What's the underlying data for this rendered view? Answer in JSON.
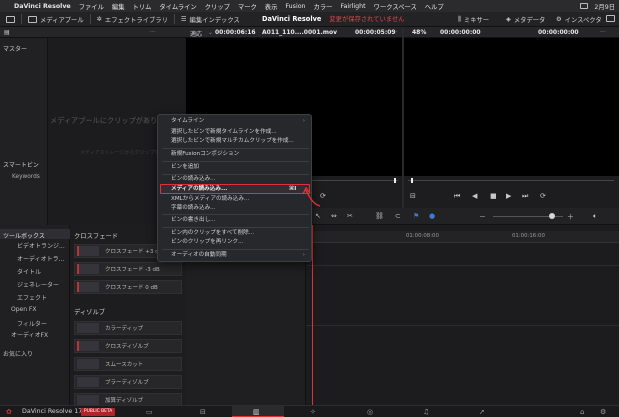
{
  "menubar": {
    "app_name": "DaVinci Resolve",
    "items": [
      "ファイル",
      "編集",
      "トリム",
      "タイムライン",
      "クリップ",
      "マーク",
      "表示",
      "Fusion",
      "カラー",
      "Fairlight",
      "ワークスペース",
      "ヘルプ"
    ],
    "date": "2月9日"
  },
  "toolbar": {
    "media_pool": "メディアプール",
    "effects_library": "エフェクトライブラリ",
    "edit_index": "編集インデックス",
    "project_name": "DaVinci Resolve",
    "unsaved_notice": "変更が保存されていません",
    "mixer": "ミキサー",
    "metadata": "メタデータ",
    "inspector": "インスペクタ"
  },
  "viewer_bar": {
    "fit": "適応",
    "source_tc": "00:00:06:16",
    "clip_name": "A011_110....0001.mov",
    "source_duration": "00:00:05:09",
    "zoom": "48%",
    "record_tc": "00:00:00:00",
    "timeline_tc": "00:00:00:00"
  },
  "left_panel": {
    "master": "マスター",
    "smart_bins": "スマートビン",
    "keywords": "Keywords"
  },
  "media_pool": {
    "empty_text": "メディアプールにクリップがありません",
    "hint_text": "メディアストレージからクリップを追加"
  },
  "toolbox": {
    "toolbox": "ツールボックス",
    "video_transitions": "ビデオトランジ...",
    "audio_transitions": "オーディオトラ...",
    "titles": "タイトル",
    "generators": "ジェネレーター",
    "effects": "エフェクト",
    "open_fx": "Open FX",
    "filters": "フィルター",
    "audio_fx": "オーディオFX",
    "favorites": "お気に入り"
  },
  "effects": {
    "crossfade_head": "クロスフェード",
    "crossfade_items": [
      "クロスフェード +3 dB",
      "クロスフェード -3 dB",
      "クロスフェード 0 dB"
    ],
    "dissolve_head": "ディゾルブ",
    "dissolve_items": [
      "カラーディップ",
      "クロスディゾルブ",
      "スムースカット",
      "ブラーディゾルブ",
      "加算ディゾルブ"
    ]
  },
  "timeline": {
    "tc_1": "01:00:08:00",
    "tc_2": "01:00:16:00"
  },
  "context_menu": {
    "timeline": "タイムライン",
    "new_timeline_from_bins": "選択したビンで新規タイムラインを作成...",
    "new_multicam_from_bins": "選択したビンで新規マルチカムクリップを作成...",
    "new_fusion_comp": "新規Fusionコンポジション",
    "add_bin": "ビンを追加",
    "import_bin": "ビンの読み込み...",
    "import_media": "メディアの読み込み...",
    "import_media_shortcut": "⌘I",
    "import_media_xml": "XMLからメディアの読み込み...",
    "import_subtitle": "字幕の読み込み...",
    "export_bin": "ビンの書き出し...",
    "delete_all_clips": "ビン内のクリップをすべて削除...",
    "relink_clips": "ビンのクリップを再リンク...",
    "audio_auto_sync": "オーディオの自動同期"
  },
  "bottombar": {
    "app_version": "DaVinci Resolve 17",
    "badge": "PUBLIC BETA"
  },
  "colors": {
    "accent_red": "#e0303a",
    "background": "#1a1a1c",
    "menu_bg": "#26282b"
  }
}
